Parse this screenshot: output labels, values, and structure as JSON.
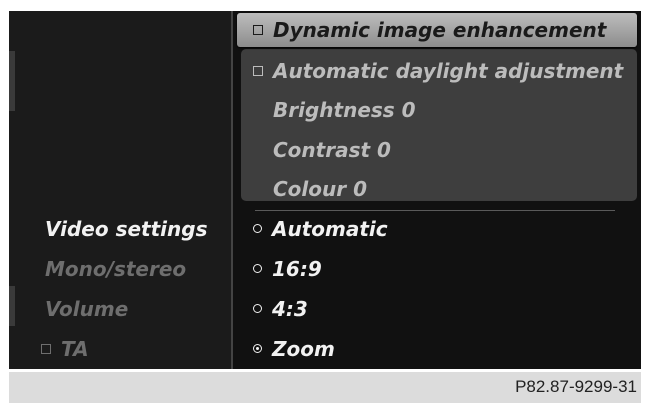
{
  "left_menu": {
    "items": [
      {
        "label": "Video settings"
      },
      {
        "label": "Mono/stereo"
      },
      {
        "label": "Volume"
      },
      {
        "label": "TA"
      }
    ]
  },
  "right_menu": {
    "options": [
      {
        "label": "Dynamic image enhancement",
        "control": "checkbox",
        "checked": false
      },
      {
        "label": "Automatic daylight adjustment",
        "control": "checkbox",
        "checked": false
      },
      {
        "label": "Brightness 0"
      },
      {
        "label": "Contrast 0"
      },
      {
        "label": "Colour 0"
      },
      {
        "label": "Automatic",
        "control": "radio",
        "selected": false
      },
      {
        "label": "16:9",
        "control": "radio",
        "selected": false
      },
      {
        "label": "4:3",
        "control": "radio",
        "selected": false
      },
      {
        "label": "Zoom",
        "control": "radio",
        "selected": true
      }
    ]
  },
  "footer": {
    "code": "P82.87-9299-31"
  },
  "colors": {
    "highlight": "#a5a5a5",
    "background": "#111111",
    "text": "#f2f2f2"
  }
}
